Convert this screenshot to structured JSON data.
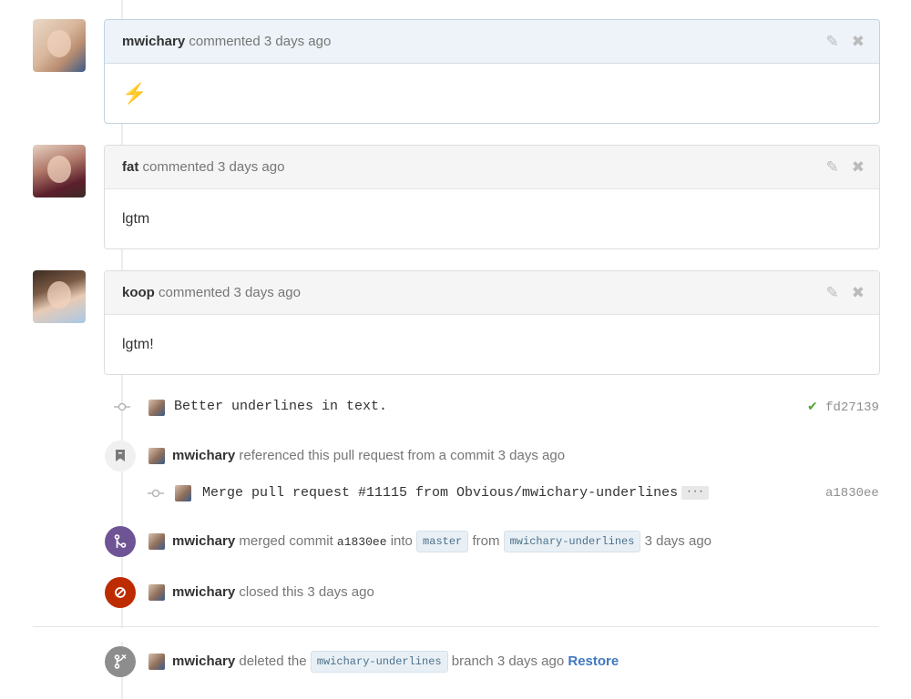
{
  "comments": [
    {
      "author": "mwichary",
      "meta": "commented 3 days ago",
      "body": "⚡"
    },
    {
      "author": "fat",
      "meta": "commented 3 days ago",
      "body": "lgtm"
    },
    {
      "author": "koop",
      "meta": "commented 3 days ago",
      "body": "lgtm!"
    }
  ],
  "icons": {
    "edit": "✎",
    "delete": "✖",
    "commit": "-o-",
    "bookmark": "bookmark-icon",
    "merge": "merge-icon",
    "closed": "closed-icon",
    "branch": "branch-icon"
  },
  "commit1": {
    "message": "Better underlines in text.",
    "status": "✔",
    "sha": "fd27139"
  },
  "referenced": {
    "author": "mwichary",
    "text": "referenced this pull request from a commit 3 days ago"
  },
  "commit2": {
    "message": "Merge pull request #11115 from Obvious/mwichary-underlines",
    "more": "···",
    "sha": "a1830ee"
  },
  "merged": {
    "author": "mwichary",
    "pre": "merged commit",
    "sha": "a1830ee",
    "into": "into",
    "base": "master",
    "from": "from",
    "head": "mwichary-underlines",
    "when": "3 days ago"
  },
  "closed": {
    "author": "mwichary",
    "text": "closed this 3 days ago"
  },
  "deleted": {
    "author": "mwichary",
    "pre": "deleted the",
    "branch": "mwichary-underlines",
    "post": "branch 3 days ago",
    "restore": "Restore"
  },
  "colors": {
    "merged": "#6e5494",
    "closed": "#bd2c00",
    "success": "#55a532",
    "link": "#4078c0"
  }
}
